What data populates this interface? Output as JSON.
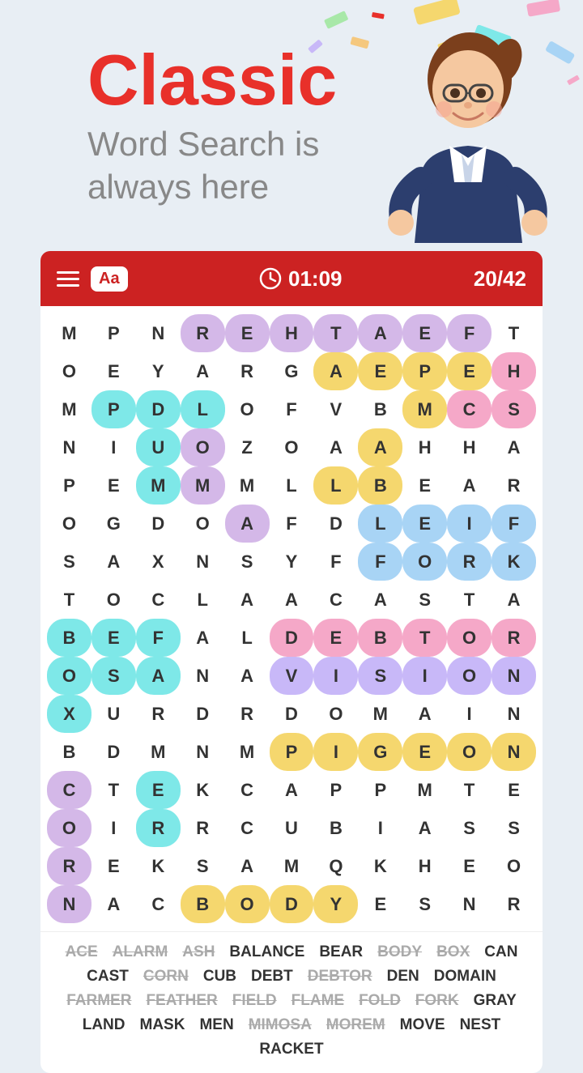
{
  "header": {
    "title": "Classic",
    "subtitle_line1": "Word Search is",
    "subtitle_line2": "always here"
  },
  "toolbar": {
    "menu_label": "menu",
    "font_label": "Aa",
    "timer": "01:09",
    "score": "20/42"
  },
  "grid": {
    "rows": [
      [
        "M",
        "P",
        "N",
        "R",
        "E",
        "H",
        "T",
        "A",
        "E",
        "F",
        "T"
      ],
      [
        "O",
        "E",
        "Y",
        "A",
        "R",
        "G",
        "A",
        "E",
        "P",
        "E",
        "H"
      ],
      [
        "M",
        "P",
        "D",
        "L",
        "O",
        "F",
        "V",
        "B",
        "M",
        "C",
        "S"
      ],
      [
        "N",
        "I",
        "U",
        "O",
        "Z",
        "O",
        "A",
        "A",
        "H",
        "H",
        "A"
      ],
      [
        "P",
        "E",
        "M",
        "M",
        "M",
        "L",
        "L",
        "B",
        "E",
        "A",
        "R"
      ],
      [
        "O",
        "G",
        "D",
        "O",
        "A",
        "F",
        "D",
        "L",
        "E",
        "I",
        "F"
      ],
      [
        "S",
        "A",
        "X",
        "N",
        "S",
        "Y",
        "F",
        "F",
        "O",
        "R",
        "K"
      ],
      [
        "T",
        "O",
        "C",
        "L",
        "A",
        "A",
        "C",
        "A",
        "S",
        "T",
        "A"
      ],
      [
        "B",
        "E",
        "F",
        "A",
        "L",
        "D",
        "E",
        "B",
        "T",
        "O",
        "R"
      ],
      [
        "O",
        "S",
        "A",
        "N",
        "A",
        "V",
        "I",
        "S",
        "I",
        "O",
        "N"
      ],
      [
        "X",
        "U",
        "R",
        "D",
        "R",
        "D",
        "O",
        "M",
        "A",
        "I",
        "N"
      ],
      [
        "B",
        "D",
        "M",
        "N",
        "M",
        "P",
        "I",
        "G",
        "E",
        "O",
        "N"
      ],
      [
        "C",
        "T",
        "E",
        "K",
        "C",
        "A",
        "P",
        "P",
        "M",
        "T",
        "E"
      ],
      [
        "O",
        "I",
        "R",
        "R",
        "C",
        "U",
        "B",
        "I",
        "A",
        "S",
        "S"
      ],
      [
        "R",
        "E",
        "K",
        "S",
        "A",
        "M",
        "Q",
        "K",
        "H",
        "E",
        "O"
      ],
      [
        "N",
        "A",
        "C",
        "B",
        "O",
        "D",
        "Y",
        "E",
        "S",
        "N",
        "R"
      ]
    ],
    "highlights": {
      "rehtaef": {
        "cells": [
          [
            0,
            3
          ],
          [
            0,
            4
          ],
          [
            0,
            5
          ],
          [
            0,
            6
          ],
          [
            0,
            7
          ],
          [
            0,
            8
          ],
          [
            0,
            9
          ]
        ],
        "color": "hl-purple"
      },
      "aep": {
        "cells": [
          [
            1,
            6
          ],
          [
            1,
            7
          ],
          [
            1,
            8
          ]
        ],
        "color": "hl-yellow"
      },
      "eh": {
        "cells": [
          [
            1,
            9
          ],
          [
            1,
            10
          ]
        ],
        "color": "hl-pink"
      },
      "pdl": {
        "cells": [
          [
            2,
            1
          ],
          [
            2,
            2
          ],
          [
            2,
            3
          ]
        ],
        "color": "hl-cyan"
      },
      "vision": {
        "cells": [
          [
            9,
            5
          ],
          [
            9,
            6
          ],
          [
            9,
            7
          ],
          [
            9,
            8
          ],
          [
            9,
            9
          ],
          [
            9,
            10
          ]
        ],
        "color": "hl-lavender"
      },
      "debtor": {
        "cells": [
          [
            8,
            5
          ],
          [
            8,
            6
          ],
          [
            8,
            7
          ],
          [
            8,
            8
          ],
          [
            8,
            9
          ],
          [
            8,
            10
          ]
        ],
        "color": "hl-pink"
      },
      "pigeon": {
        "cells": [
          [
            11,
            5
          ],
          [
            11,
            6
          ],
          [
            11,
            7
          ],
          [
            11,
            8
          ],
          [
            11,
            9
          ],
          [
            11,
            10
          ]
        ],
        "color": "hl-yellow"
      },
      "fork": {
        "cells": [
          [
            6,
            7
          ],
          [
            6,
            8
          ],
          [
            6,
            9
          ],
          [
            6,
            10
          ]
        ],
        "color": "hl-blue"
      },
      "box": {
        "cells": [
          [
            8,
            0
          ],
          [
            9,
            0
          ],
          [
            10,
            0
          ]
        ],
        "color": "hl-cyan"
      },
      "bef": {
        "cells": [
          [
            8,
            0
          ],
          [
            8,
            1
          ],
          [
            8,
            2
          ]
        ],
        "color": "hl-cyan"
      },
      "osa": {
        "cells": [
          [
            9,
            0
          ],
          [
            9,
            1
          ],
          [
            9,
            2
          ]
        ],
        "color": "hl-cyan"
      },
      "body": {
        "cells": [
          [
            15,
            3
          ],
          [
            15,
            4
          ],
          [
            15,
            5
          ],
          [
            15,
            6
          ]
        ],
        "color": "hl-yellow"
      },
      "corn": {
        "cells": [
          [
            12,
            0
          ],
          [
            13,
            0
          ],
          [
            14,
            0
          ],
          [
            15,
            0
          ]
        ],
        "color": "hl-purple"
      },
      "field": {
        "cells": [
          [
            5,
            7
          ],
          [
            5,
            8
          ],
          [
            5,
            9
          ],
          [
            5,
            10
          ],
          [
            4,
            10
          ]
        ],
        "color": "hl-blue"
      },
      "flame": {
        "cells": [],
        "color": "hl-orange"
      }
    }
  },
  "words": [
    {
      "text": "ACE",
      "found": true
    },
    {
      "text": "ALARM",
      "found": true
    },
    {
      "text": "ASH",
      "found": true
    },
    {
      "text": "BALANCE",
      "found": false
    },
    {
      "text": "BEAR",
      "found": false
    },
    {
      "text": "BODY",
      "found": true
    },
    {
      "text": "BOX",
      "found": true
    },
    {
      "text": "CAN",
      "found": false
    },
    {
      "text": "CAST",
      "found": false
    },
    {
      "text": "CORN",
      "found": true
    },
    {
      "text": "CUB",
      "found": false
    },
    {
      "text": "DEBT",
      "found": false
    },
    {
      "text": "DEBTOR",
      "found": true
    },
    {
      "text": "DEN",
      "found": false
    },
    {
      "text": "DOMAIN",
      "found": false
    },
    {
      "text": "FARMER",
      "found": true
    },
    {
      "text": "FEATHER",
      "found": true
    },
    {
      "text": "FIELD",
      "found": true
    },
    {
      "text": "FLAME",
      "found": true
    },
    {
      "text": "FOLD",
      "found": true
    },
    {
      "text": "FORK",
      "found": true
    },
    {
      "text": "GRAY",
      "found": false
    },
    {
      "text": "LAND",
      "found": false
    },
    {
      "text": "MASK",
      "found": false
    },
    {
      "text": "MEN",
      "found": false
    },
    {
      "text": "MIMOSA",
      "found": true
    },
    {
      "text": "MOREM",
      "found": true
    },
    {
      "text": "MOVE",
      "found": false
    },
    {
      "text": "NEST",
      "found": false
    },
    {
      "text": "RACKET",
      "found": false
    }
  ]
}
